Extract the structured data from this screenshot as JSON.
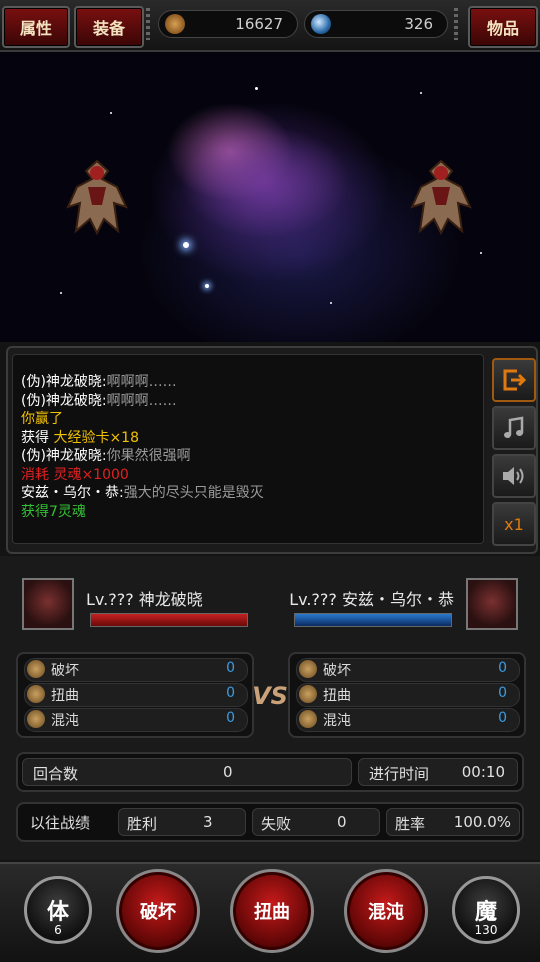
{
  "top_bar": {
    "attributes_label": "属性",
    "equipment_label": "装备",
    "items_label": "物品",
    "gold": "16627",
    "gems": "326"
  },
  "log": {
    "lines": [
      {
        "speaker": "(伪)神龙破晓:",
        "text": "啊啊啊……",
        "color": "#9a9a9a"
      },
      {
        "speaker": "(伪)神龙破晓:",
        "text": "啊啊啊……",
        "color": "#9a9a9a"
      },
      {
        "speaker": "",
        "text": "你赢了",
        "color": "#f2c200"
      },
      {
        "speaker": "获得 ",
        "text": "大经验卡×18",
        "color": "#f2c200"
      },
      {
        "speaker": "(伪)神龙破晓:",
        "text": "你果然很强啊",
        "color": "#9a9a9a"
      },
      {
        "speaker": "消耗 ",
        "text": "灵魂×1000",
        "color": "#e02020"
      },
      {
        "speaker": "安兹・乌尔・恭:",
        "text": "强大的尽头只能是毁灭",
        "color": "#9a9a9a"
      },
      {
        "speaker": "",
        "text": "获得7灵魂",
        "color": "#34c034"
      }
    ],
    "speed_label": "x1"
  },
  "player_left": {
    "name": "Lv.??? 神龙破晓"
  },
  "player_right": {
    "name": "Lv.??? 安兹・乌尔・恭"
  },
  "stats_left": [
    {
      "label": "破坏",
      "value": "0"
    },
    {
      "label": "扭曲",
      "value": "0"
    },
    {
      "label": "混沌",
      "value": "0"
    }
  ],
  "stats_right": [
    {
      "label": "破坏",
      "value": "0"
    },
    {
      "label": "扭曲",
      "value": "0"
    },
    {
      "label": "混沌",
      "value": "0"
    }
  ],
  "vs_label": "VS",
  "round": {
    "label": "回合数",
    "value": "0",
    "time_label": "进行时间",
    "time_value": "00:10"
  },
  "history": {
    "label": "以往战绩",
    "win_label": "胜利",
    "win_value": "3",
    "loss_label": "失败",
    "loss_value": "0",
    "rate_label": "胜率",
    "rate_value": "100.0%"
  },
  "bottom": {
    "stamina_label": "体",
    "stamina_value": "6",
    "destroy_label": "破坏",
    "twist_label": "扭曲",
    "chaos_label": "混沌",
    "magic_label": "魔",
    "magic_value": "130"
  },
  "colors": {
    "accent_red": "#a51010",
    "hp_red": "#b01818",
    "hp_blue": "#1e5fb0",
    "stat_value_blue": "#3d9be0",
    "exit_orange": "#e07a10"
  }
}
